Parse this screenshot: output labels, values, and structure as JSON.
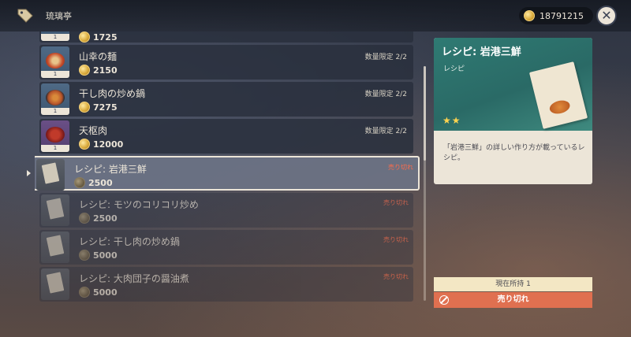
{
  "header": {
    "shop_name": "琉璃亭",
    "currency_icon": "mora-coin-icon",
    "currency_amount": "18791215"
  },
  "list": {
    "partial_top_price": "1725",
    "items": [
      {
        "name": "山幸の麺",
        "price": "2150",
        "limit": "数量限定 2/2",
        "qty": "1",
        "icon": "noodle-dish-icon",
        "dish_color": "#c44b2a"
      },
      {
        "name": "干し肉の炒め鍋",
        "price": "7275",
        "limit": "数量限定 2/2",
        "qty": "1",
        "icon": "stir-fry-pot-icon",
        "dish_color": "#b5532a"
      },
      {
        "name": "天枢肉",
        "price": "12000",
        "limit": "数量限定 2/2",
        "qty": "1",
        "icon": "braised-meat-icon",
        "dish_color": "#a92a2a"
      },
      {
        "name": "レシピ: 岩港三鮮",
        "price": "2500",
        "status": "売り切れ",
        "icon": "recipe-icon",
        "selected": true
      },
      {
        "name": "レシピ: モツのコリコリ炒め",
        "price": "2500",
        "status": "売り切れ",
        "icon": "recipe-icon"
      },
      {
        "name": "レシピ: 干し肉の炒め鍋",
        "price": "5000",
        "status": "売り切れ",
        "icon": "recipe-icon"
      },
      {
        "name": "レシピ: 大肉団子の醤油煮",
        "price": "5000",
        "status": "売り切れ",
        "icon": "recipe-icon"
      }
    ]
  },
  "detail": {
    "title": "レシピ: 岩港三鮮",
    "category": "レシピ",
    "stars": "★★",
    "description": "「岩港三鮮」の詳しい作り方が載っているレシピ。",
    "owned": "現在所持 1",
    "action": "売り切れ"
  },
  "colors": {
    "accent_teal": "#2f7a73",
    "soldout_red": "#e07050",
    "panel_cream": "#ece5d8"
  }
}
